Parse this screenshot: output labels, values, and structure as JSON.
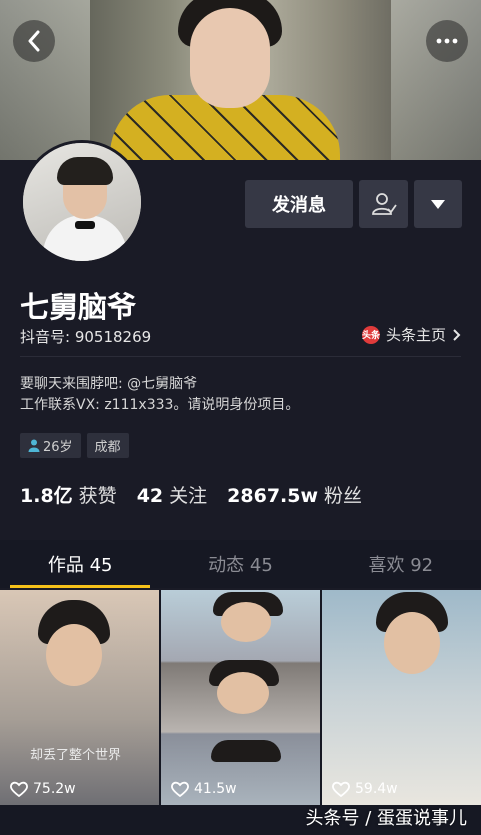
{
  "header": {
    "back_icon": "back-arrow-icon",
    "more_icon": "more-dots-icon"
  },
  "profile": {
    "name": "七舅脑爷",
    "douyin_id": "抖音号: 90518269",
    "toutiao_link": "头条主页",
    "toutiao_logo_text": "头条",
    "bio_line1": "要聊天来围脖吧: @七舅脑爷",
    "bio_line2": "工作联系VX: z111x333。请说明身份项目。",
    "tag_age": "26岁",
    "tag_city": "成都"
  },
  "actions": {
    "message_label": "发消息"
  },
  "stats": {
    "likes_value": "1.8亿",
    "likes_label": "获赞",
    "following_value": "42",
    "following_label": "关注",
    "followers_value": "2867.5w",
    "followers_label": "粉丝"
  },
  "tabs": [
    {
      "label": "作品 45",
      "active": true
    },
    {
      "label": "动态 45",
      "active": false
    },
    {
      "label": "喜欢 92",
      "active": false
    }
  ],
  "videos": [
    {
      "caption": "却丢了整个世界",
      "likes": "75.2w"
    },
    {
      "caption": "",
      "likes": "41.5w"
    },
    {
      "caption": "",
      "likes": "59.4w"
    }
  ],
  "watermark": "头条号 / 蛋蛋说事儿",
  "colors": {
    "accent": "#f6c21a",
    "background": "#161823",
    "button": "#363845",
    "toutiao_red": "#e03b3b"
  }
}
